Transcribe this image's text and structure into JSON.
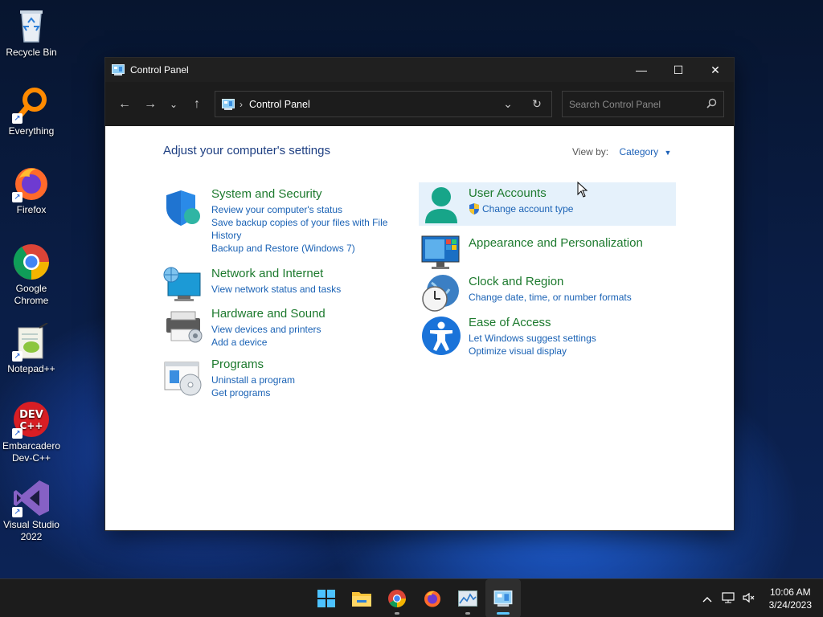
{
  "desktop": {
    "icons": [
      {
        "label": "Recycle Bin"
      },
      {
        "label": "Everything"
      },
      {
        "label": "Firefox"
      },
      {
        "label": "Google Chrome"
      },
      {
        "label": "Notepad++"
      },
      {
        "label": "Embarcadero Dev-C++"
      },
      {
        "label": "Visual Studio 2022"
      }
    ]
  },
  "window": {
    "title": "Control Panel",
    "controls": {
      "minimize": "—",
      "maximize": "☐",
      "close": "✕"
    },
    "nav": {
      "back": "←",
      "forward": "→",
      "recent": "⌄",
      "up": "↑"
    },
    "address": {
      "separator": "›",
      "crumb": "Control Panel",
      "dropdown": "⌄",
      "refresh": "↻"
    },
    "search": {
      "placeholder": "Search Control Panel",
      "icon": "search-icon"
    }
  },
  "content": {
    "heading": "Adjust your computer's settings",
    "view_by": {
      "label": "View by:",
      "value": "Category"
    },
    "categories": [
      {
        "title": "System and Security",
        "links": [
          "Review your computer's status",
          "Save backup copies of your files with File History",
          "Backup and Restore (Windows 7)"
        ],
        "icon": "shield-icon"
      },
      {
        "title": "Network and Internet",
        "links": [
          "View network status and tasks"
        ],
        "icon": "globe-network-icon"
      },
      {
        "title": "Hardware and Sound",
        "links": [
          "View devices and printers",
          "Add a device"
        ],
        "icon": "printer-icon"
      },
      {
        "title": "Programs",
        "links": [
          "Uninstall a program",
          "Get programs"
        ],
        "icon": "programs-icon"
      },
      {
        "title": "User Accounts",
        "links": [
          "Change account type"
        ],
        "icon": "user-icon"
      },
      {
        "title": "Appearance and Personalization",
        "links": [],
        "icon": "monitor-icon"
      },
      {
        "title": "Clock and Region",
        "links": [
          "Change date, time, or number formats"
        ],
        "icon": "clock-globe-icon"
      },
      {
        "title": "Ease of Access",
        "links": [
          "Let Windows suggest settings",
          "Optimize visual display"
        ],
        "icon": "accessibility-icon"
      }
    ]
  },
  "taskbar": {
    "apps": [
      "start-icon",
      "file-explorer-icon",
      "chrome-icon",
      "firefox-icon",
      "task-manager-icon",
      "control-panel-icon"
    ],
    "tray": {
      "chevron": "^",
      "time": "10:06 AM",
      "date": "3/24/2023"
    }
  },
  "colors": {
    "link": "#1a62b5",
    "category_title": "#1d7a2e",
    "heading": "#1e3f82",
    "accent": "#5cc8ff"
  }
}
